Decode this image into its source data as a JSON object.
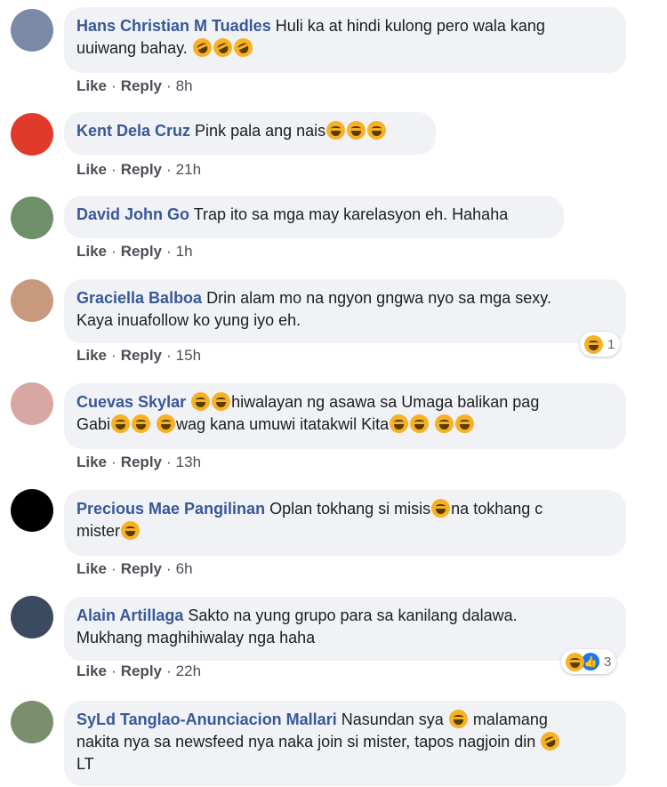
{
  "actions": {
    "like": "Like",
    "reply": "Reply",
    "sep": "·"
  },
  "comments": [
    {
      "author": "Hans Christian M Tuadles",
      "text": "Huli ka at hindi kulong pero wala kang",
      "text2": "uuiwang bahay.",
      "time": "8h",
      "avatar_color": "#7a8aa6"
    },
    {
      "author": "Kent Dela Cruz",
      "text": "Pink pala ang nais",
      "time": "21h",
      "avatar_color": "#e23a2a"
    },
    {
      "author": "David John Go",
      "text": "Trap ito sa mga may karelasyon eh. Hahaha",
      "time": "1h",
      "avatar_color": "#6f8f6a"
    },
    {
      "author": "Graciella Balboa",
      "text": "Drin alam mo na ngyon gngwa nyo sa mga sexy.",
      "text2": "Kaya inuafollow ko yung iyo eh.",
      "time": "15h",
      "reaction_count": "1",
      "avatar_color": "#c89a7d"
    },
    {
      "author": "Cuevas Skylar",
      "text": "hiwalayan ng asawa sa Umaga balikan pag",
      "text2a": "Gabi",
      "text2b": "wag kana umuwi itatakwil Kita",
      "time": "13h",
      "avatar_color": "#d9a7a3"
    },
    {
      "author": "Precious Mae Pangilinan",
      "text": "Oplan tokhang si misis",
      "text1b": "na tokhang c",
      "text2": "mister",
      "time": "6h",
      "avatar_color": "#000000"
    },
    {
      "author": "Alain Artillaga",
      "text": "Sakto na yung grupo para sa kanilang dalawa.",
      "text2": "Mukhang maghihiwalay nga haha",
      "time": "22h",
      "reaction_count": "3",
      "avatar_color": "#3b4a5e"
    },
    {
      "author": "SyLd Tanglao-Anunciacion Mallari",
      "text": "Nasundan sya",
      "text1b": "malamang",
      "text2": "nakita nya sa newsfeed nya naka join si mister, tapos nagjoin din",
      "text3": "LT",
      "avatar_color": "#7a8f6e"
    }
  ],
  "icons": {
    "laugh": "laughing-emoji-icon",
    "rofl": "rolling-laughing-emoji-icon",
    "like": "like-reaction-icon"
  },
  "colors": {
    "author": "#385898",
    "bubble": "#f0f2f5",
    "like_blue": "#1877f2"
  }
}
